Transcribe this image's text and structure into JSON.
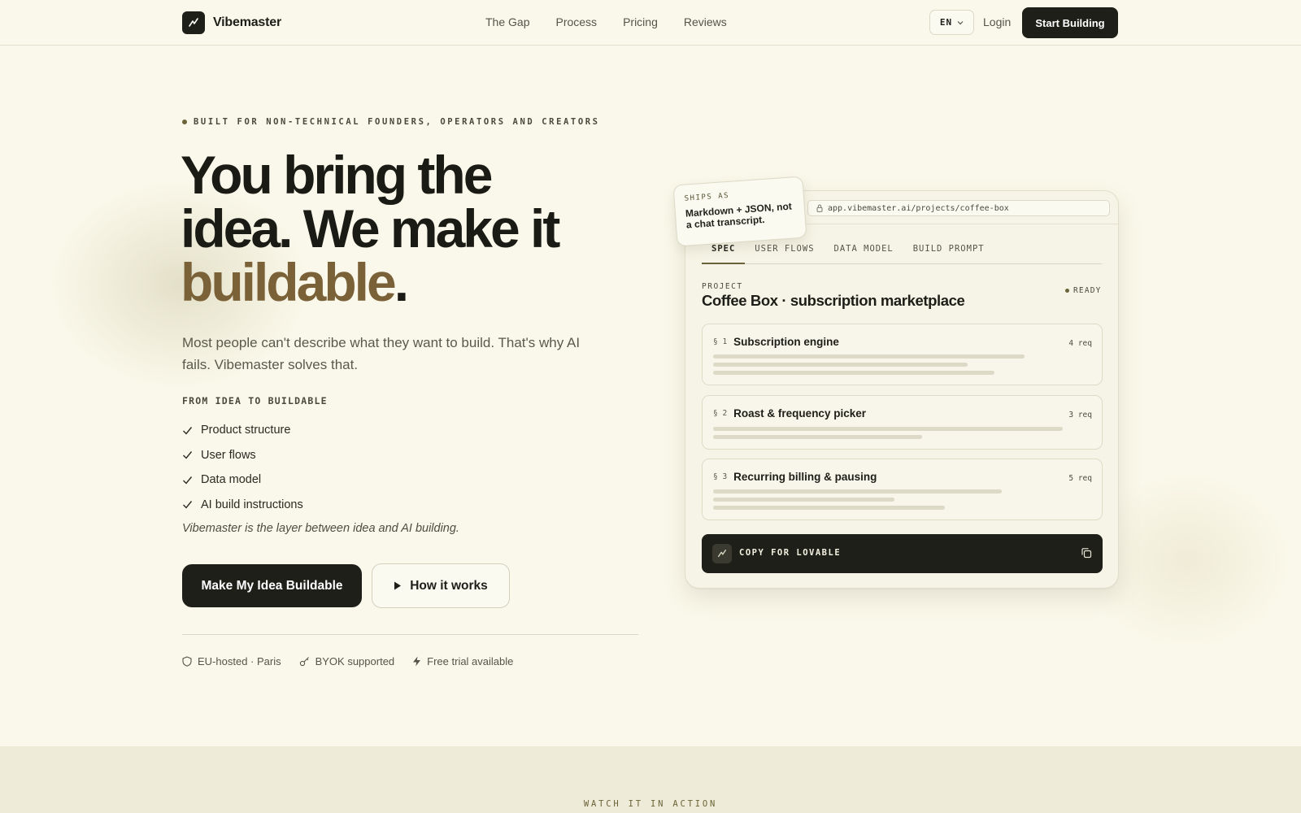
{
  "nav": {
    "brand": "Vibemaster",
    "links": [
      "The Gap",
      "Process",
      "Pricing",
      "Reviews"
    ],
    "language": "EN",
    "login": "Login",
    "cta": "Start Building"
  },
  "hero": {
    "eyebrow": "BUILT FOR NON-TECHNICAL FOUNDERS, OPERATORS AND CREATORS",
    "headline_line1": "You bring the",
    "headline_line2": "idea. We make it",
    "headline_accent": "buildable",
    "headline_period": ".",
    "subtitle": "Most people can't describe what they want to build. That's why AI fails. Vibemaster solves that.",
    "list_title": "FROM IDEA TO BUILDABLE",
    "checklist": [
      "Product structure",
      "User flows",
      "Data model",
      "AI build instructions"
    ],
    "tagline": "Vibemaster is the layer between idea and AI building.",
    "primary_cta": "Make My Idea Buildable",
    "secondary_cta": "How it works",
    "badges": [
      "EU-hosted · Paris",
      "BYOK supported",
      "Free trial available"
    ]
  },
  "mockup": {
    "ships_label": "SHIPS AS",
    "ships_text": "Markdown + JSON, not a chat transcript.",
    "url": "app.vibemaster.ai/projects/coffee-box",
    "tabs": [
      "SPEC",
      "USER FLOWS",
      "DATA MODEL",
      "BUILD PROMPT"
    ],
    "active_tab": "SPEC",
    "project_label": "PROJECT",
    "project_title": "Coffee Box · subscription marketplace",
    "status": "READY",
    "sections": [
      {
        "num": "§ 1",
        "title": "Subscription engine",
        "req": "4 req"
      },
      {
        "num": "§ 2",
        "title": "Roast & frequency picker",
        "req": "3 req"
      },
      {
        "num": "§ 3",
        "title": "Recurring billing & pausing",
        "req": "5 req"
      }
    ],
    "copy_label": "COPY FOR LOVABLE"
  },
  "footer_band": {
    "eyebrow": "WATCH IT IN ACTION"
  },
  "colors": {
    "background": "#faf8ea",
    "dark": "#1f1f19",
    "accent": "#7a6138",
    "band": "#eeebd8"
  },
  "icons": {
    "logo": "trend-line-icon",
    "check": "check-icon",
    "play": "play-icon",
    "shield": "shield-icon",
    "key": "key-icon",
    "bolt": "bolt-icon",
    "lock": "lock-icon",
    "copy": "copy-icon",
    "chevron": "chevron-down-icon"
  }
}
